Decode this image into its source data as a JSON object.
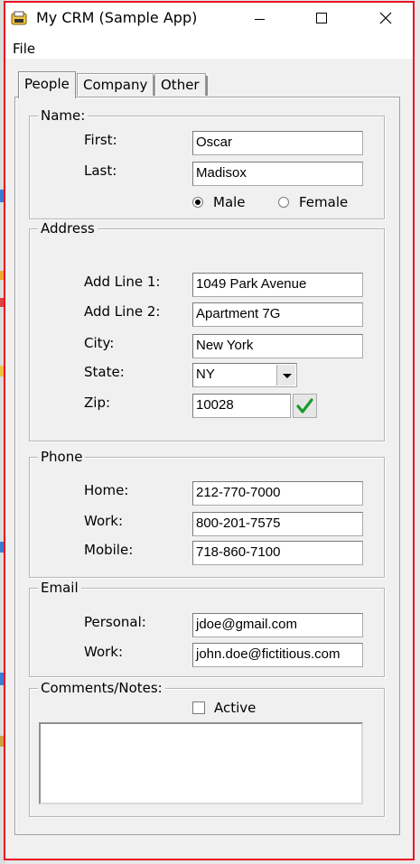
{
  "window": {
    "title": "My CRM (Sample App)",
    "accent_border": "#e81123"
  },
  "menu": {
    "file": "File"
  },
  "tabs": [
    {
      "label": "People",
      "active": true
    },
    {
      "label": "Company",
      "active": false
    },
    {
      "label": "Other",
      "active": false
    }
  ],
  "name": {
    "legend": "Name:",
    "first_label": "First:",
    "first_value": "Oscar",
    "last_label": "Last:",
    "last_value": "Madisox",
    "male_label": "Male",
    "female_label": "Female",
    "selected_gender": "Male"
  },
  "address": {
    "legend": "Address",
    "line1_label": "Add Line 1:",
    "line1_value": "1049 Park Avenue",
    "line2_label": "Add Line 2:",
    "line2_value": "Apartment 7G",
    "city_label": "City:",
    "city_value": "New York",
    "state_label": "State:",
    "state_value": "NY",
    "zip_label": "Zip:",
    "zip_value": "10028",
    "zip_valid_icon": "green-checkmark-icon"
  },
  "phone": {
    "legend": "Phone",
    "home_label": "Home:",
    "home_value": "212-770-7000",
    "work_label": "Work:",
    "work_value": "800-201-7575",
    "mobile_label": "Mobile:",
    "mobile_value": "718-860-7100"
  },
  "email": {
    "legend": "Email",
    "personal_label": "Personal:",
    "personal_value": "jdoe@gmail.com",
    "work_label": "Work:",
    "work_value": "john.doe@fictitious.com"
  },
  "comments": {
    "legend": "Comments/Notes:",
    "active_label": "Active",
    "active_checked": false,
    "notes_value": ""
  }
}
